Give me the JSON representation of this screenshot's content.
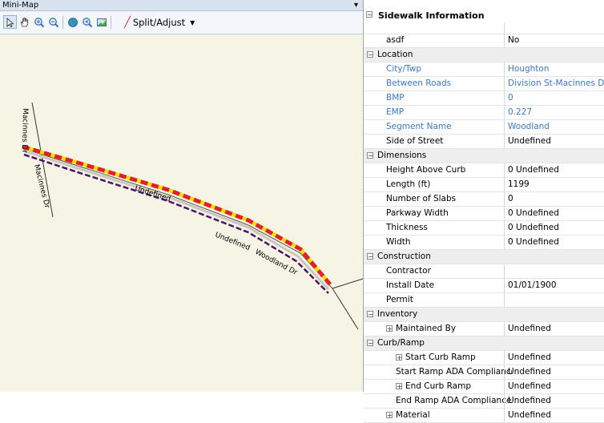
{
  "minimap": {
    "title": "Mini-Map",
    "pin_icon": "pin-icon",
    "toolbar": {
      "split_label": "Split/Adjust"
    },
    "labels": {
      "road_vertical_1": "Macinnes Dr",
      "road_vertical_2": "Macinnes Dr",
      "undefined_upper": "Undefined",
      "undefined_lower": "Undefined",
      "woodland": "Woodland Dr"
    },
    "colors": {
      "map_bg": "#f6f4e4",
      "red_dash": "#e0202a",
      "yellow_dash": "#f2e200",
      "purple_dash": "#4b1466"
    }
  },
  "props": {
    "header": "Sidewalk Information",
    "rows": [
      {
        "type": "top",
        "label": "asdf",
        "value": "No"
      },
      {
        "type": "cat",
        "label": "Location"
      },
      {
        "type": "blue",
        "label": "City/Twp",
        "value": "Houghton"
      },
      {
        "type": "blue",
        "label": "Between Roads",
        "value": "Division St-Macinnes Dr"
      },
      {
        "type": "blue",
        "label": "BMP",
        "value": "0"
      },
      {
        "type": "blue",
        "label": "EMP",
        "value": "0.227"
      },
      {
        "type": "blue",
        "label": "Segment Name",
        "value": "Woodland"
      },
      {
        "type": "normal",
        "label": "Side of Street",
        "value": "Undefined"
      },
      {
        "type": "cat",
        "label": "Dimensions"
      },
      {
        "type": "normal",
        "label": "Height Above Curb",
        "value": "0 Undefined"
      },
      {
        "type": "normal",
        "label": "Length (ft)",
        "value": "1199"
      },
      {
        "type": "normal",
        "label": "Number of Slabs",
        "value": "0"
      },
      {
        "type": "normal",
        "label": "Parkway Width",
        "value": "0 Undefined"
      },
      {
        "type": "normal",
        "label": "Thickness",
        "value": "0 Undefined"
      },
      {
        "type": "normal",
        "label": "Width",
        "value": "0 Undefined"
      },
      {
        "type": "cat",
        "label": "Construction"
      },
      {
        "type": "normal",
        "label": "Contractor",
        "value": ""
      },
      {
        "type": "normal",
        "label": "Install Date",
        "value": "01/01/1900"
      },
      {
        "type": "normal",
        "label": "Permit",
        "value": ""
      },
      {
        "type": "cat",
        "label": "Inventory"
      },
      {
        "type": "sub",
        "label": "Maintained By",
        "value": "Undefined"
      },
      {
        "type": "cat",
        "label": "Curb/Ramp"
      },
      {
        "type": "sub2",
        "label": "Start Curb Ramp",
        "value": "Undefined"
      },
      {
        "type": "indent",
        "label": "Start Ramp ADA Compliance",
        "value": "Undefined"
      },
      {
        "type": "sub2",
        "label": "End Curb Ramp",
        "value": "Undefined"
      },
      {
        "type": "indent",
        "label": "End Ramp ADA Compliance",
        "value": "Undefined"
      },
      {
        "type": "sub",
        "label": "Material",
        "value": "Undefined"
      }
    ]
  }
}
